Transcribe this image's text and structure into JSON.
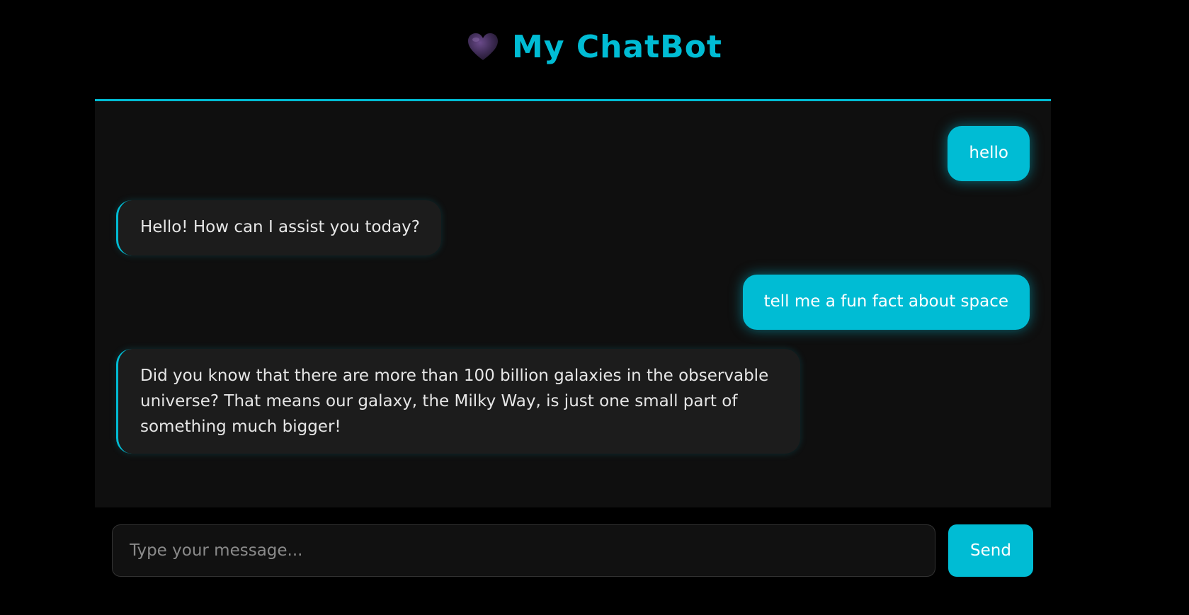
{
  "header": {
    "icon": "heart-icon",
    "title": "My ChatBot"
  },
  "colors": {
    "accent": "#00bcd4",
    "background": "#000000",
    "panel": "#0f0f0f",
    "bot_bubble": "#1c1c1c"
  },
  "messages": [
    {
      "role": "user",
      "text": "hello"
    },
    {
      "role": "bot",
      "text": "Hello! How can I assist you today?"
    },
    {
      "role": "user",
      "text": "tell me a fun fact about space"
    },
    {
      "role": "bot",
      "text": "Did you know that there are more than 100 billion galaxies in the observable universe? That means our galaxy, the Milky Way, is just one small part of something much bigger!"
    }
  ],
  "input": {
    "placeholder": "Type your message...",
    "value": ""
  },
  "send_label": "Send"
}
